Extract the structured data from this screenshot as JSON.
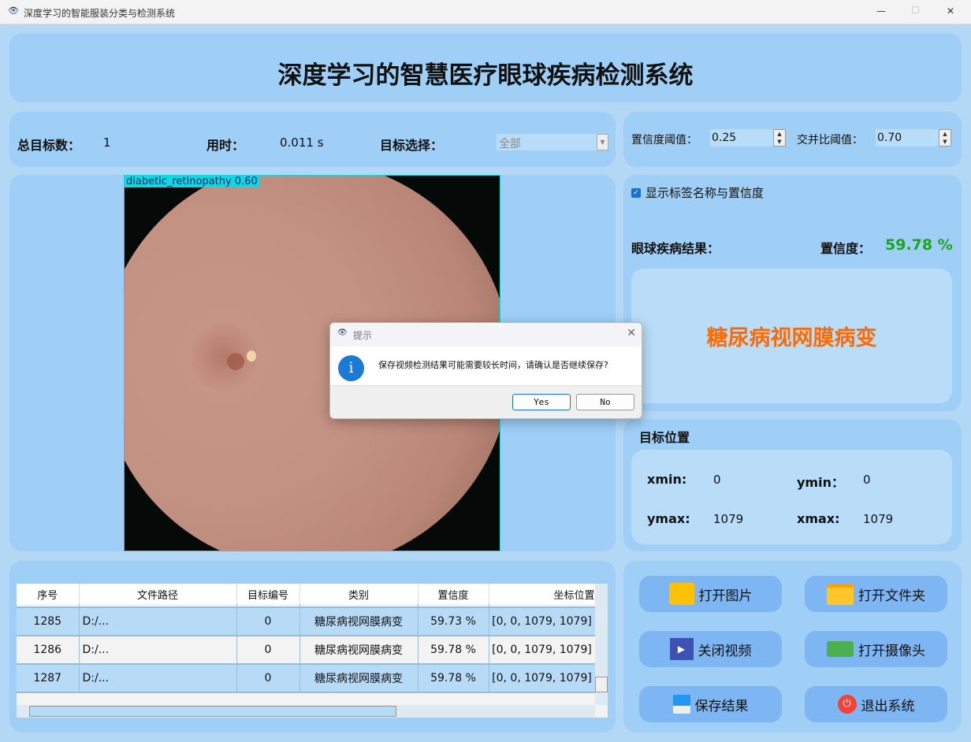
{
  "window": {
    "title": "深度学习的智能服装分类与检测系统",
    "min": "—",
    "max": "☐",
    "close": "✕"
  },
  "header": {
    "title": "深度学习的智慧医疗眼球疾病检测系统"
  },
  "stats": {
    "total_label": "总目标数：",
    "total_value": "1",
    "time_label": "用时：",
    "time_value": "0.011 s",
    "select_label": "目标选择：",
    "select_value": "全部"
  },
  "thresholds": {
    "conf_label": "置信度阈值：",
    "conf_value": "0.25",
    "iou_label": "交并比阈值：",
    "iou_value": "0.70"
  },
  "image": {
    "detection_label": "diabetic_retinopathy  0.60"
  },
  "result": {
    "show_label_checkbox": "显示标签名称与置信度",
    "show_label_checked": true,
    "disease_label": "眼球疾病结果：",
    "conf_label": "置信度：",
    "conf_value": "59.78 %",
    "disease_value": "糖尿病视网膜病变",
    "accent": "#ff6a00",
    "conf_color": "#1aa51a"
  },
  "position": {
    "title": "目标位置",
    "xmin_label": "xmin:",
    "xmin": "0",
    "ymin_label": "ymin：",
    "ymin": "0",
    "ymax_label": "ymax:",
    "ymax": "1079",
    "xmax_label": "xmax:",
    "xmax": "1079"
  },
  "table": {
    "headers": [
      "序号",
      "文件路径",
      "目标编号",
      "类别",
      "置信度",
      "坐标位置"
    ],
    "rows": [
      [
        "1285",
        "D:/...",
        "0",
        "糖尿病视网膜病变",
        "59.73 %",
        "[0, 0, 1079, 1079]"
      ],
      [
        "1286",
        "D:/...",
        "0",
        "糖尿病视网膜病变",
        "59.78 %",
        "[0, 0, 1079, 1079]"
      ],
      [
        "1287",
        "D:/...",
        "0",
        "糖尿病视网膜病变",
        "59.78 %",
        "[0, 0, 1079, 1079]"
      ]
    ]
  },
  "buttons": {
    "open_image": "打开图片",
    "open_folder": "打开文件夹",
    "close_video": "关闭视频",
    "open_camera": "打开摄像头",
    "save": "保存结果",
    "exit": "退出系统"
  },
  "dialog": {
    "title": "提示",
    "message": "保存视频检测结果可能需要较长时间，请确认是否继续保存?",
    "yes": "Yes",
    "no": "No"
  }
}
